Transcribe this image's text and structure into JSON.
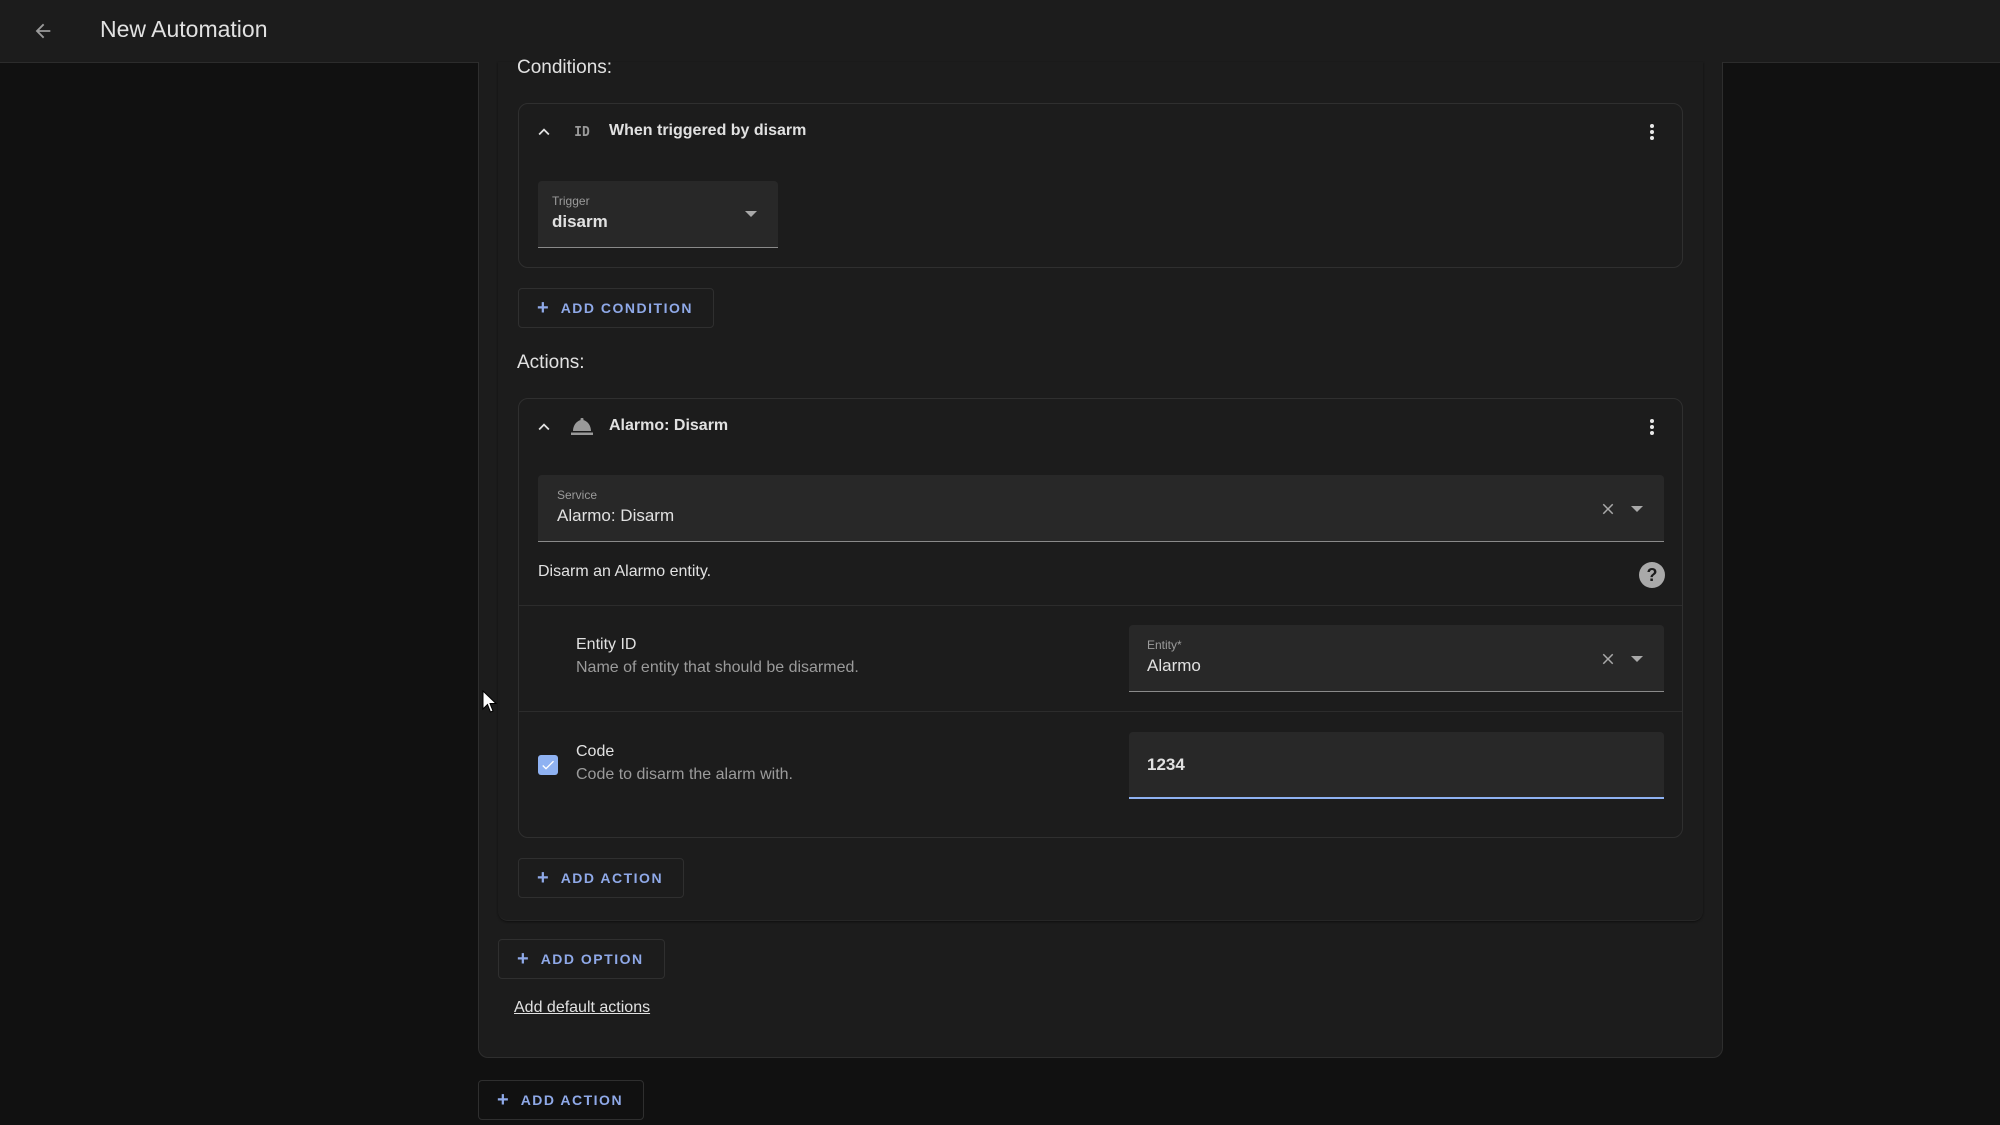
{
  "header": {
    "back_icon": "arrow-left-icon",
    "title": "New Automation"
  },
  "conditions": {
    "label": "Conditions:",
    "items": [
      {
        "icon": "id-icon",
        "icon_text": "ID",
        "title": "When triggered by disarm",
        "field": {
          "label": "Trigger",
          "value": "disarm"
        }
      }
    ],
    "add_button": "ADD CONDITION"
  },
  "actions": {
    "label": "Actions:",
    "items": [
      {
        "icon": "bell-icon",
        "title": "Alarmo: Disarm",
        "service_field": {
          "label": "Service",
          "value": "Alarmo: Disarm"
        },
        "description": "Disarm an Alarmo entity.",
        "params": [
          {
            "title": "Entity ID",
            "subtitle": "Name of entity that should be disarmed.",
            "field_label": "Entity*",
            "field_value": "Alarmo"
          },
          {
            "title": "Code",
            "subtitle": "Code to disarm the alarm with.",
            "checked": true,
            "field_value": "1234"
          }
        ]
      }
    ],
    "add_button": "ADD ACTION"
  },
  "option_footer": {
    "add_option_button": "ADD OPTION",
    "add_default_actions_link": "Add default actions"
  },
  "outer_add_action_button": "ADD ACTION",
  "colors": {
    "accent": "#8fa9e8",
    "checkbox": "#8fb2f2",
    "background": "#111111",
    "card": "#1c1c1c"
  }
}
